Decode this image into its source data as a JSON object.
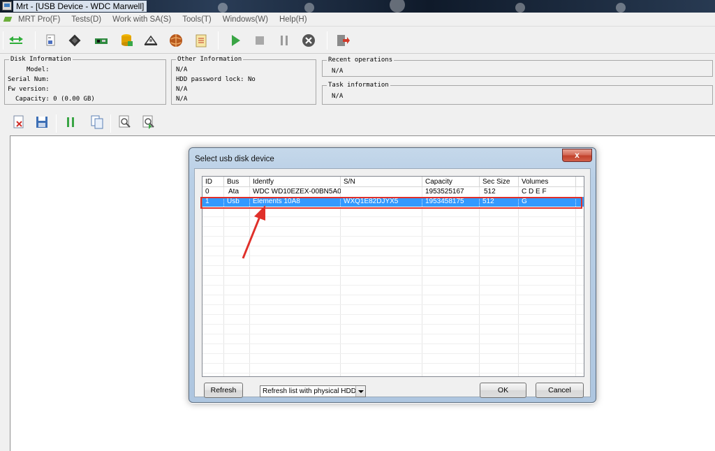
{
  "window": {
    "title": "Mrt - [USB Device - WDC Marwell]"
  },
  "menu": [
    "MRT Pro(F)",
    "Tests(D)",
    "Work with SA(S)",
    "Tools(T)",
    "Windows(W)",
    "Help(H)"
  ],
  "toolbar": {
    "icons": [
      "connect-icon",
      "disk-info-icon",
      "chip-icon",
      "board-icon",
      "database-icon",
      "scale-icon",
      "globe-icon",
      "notes-icon",
      "play-icon",
      "stop-icon",
      "pause-icon",
      "cancel-icon",
      "exit-icon"
    ]
  },
  "disk_info": {
    "legend": "Disk Information",
    "model": "Model:",
    "serial": "Serial Num:",
    "fw": "Fw version:",
    "capacity": "Capacity: 0 (0.00 GB)"
  },
  "other_info": {
    "legend": "Other Information",
    "line1": "N/A",
    "line2": "HDD password lock: No",
    "line3": "N/A",
    "line4": "N/A"
  },
  "recent_ops": {
    "legend": "Recent operations",
    "value": "N/A"
  },
  "task_info": {
    "legend": "Task information",
    "value": "N/A"
  },
  "toolbar2": {
    "icons": [
      "delete-file-icon",
      "save-icon",
      "pause-log-icon",
      "copy-icon",
      "search-icon",
      "search-next-icon"
    ]
  },
  "dialog": {
    "title": "Select usb disk device",
    "close_label": "x",
    "columns": [
      "ID",
      "Bus",
      "Identfy",
      "S/N",
      "Capacity",
      "Sec Size",
      "Volumes"
    ],
    "rows": [
      {
        "id": "0",
        "bus": "Ata",
        "identify": "WDC WD10EZEX-00BN5A0",
        "sn": "",
        "capacity": "1953525167",
        "sec_size": "512",
        "volumes": "C D E F"
      },
      {
        "id": "1",
        "bus": "Usb",
        "identify": "Elements 10A8",
        "sn": "WXQ1E82DJYX5",
        "capacity": "1953458175",
        "sec_size": "512",
        "volumes": "G"
      }
    ],
    "selected_row": 1,
    "refresh_label": "Refresh",
    "combo_value": "Refresh list with physical HDD",
    "ok_label": "OK",
    "cancel_label": "Cancel"
  },
  "colors": {
    "selection": "#3399ff",
    "highlight": "#e0302a"
  }
}
